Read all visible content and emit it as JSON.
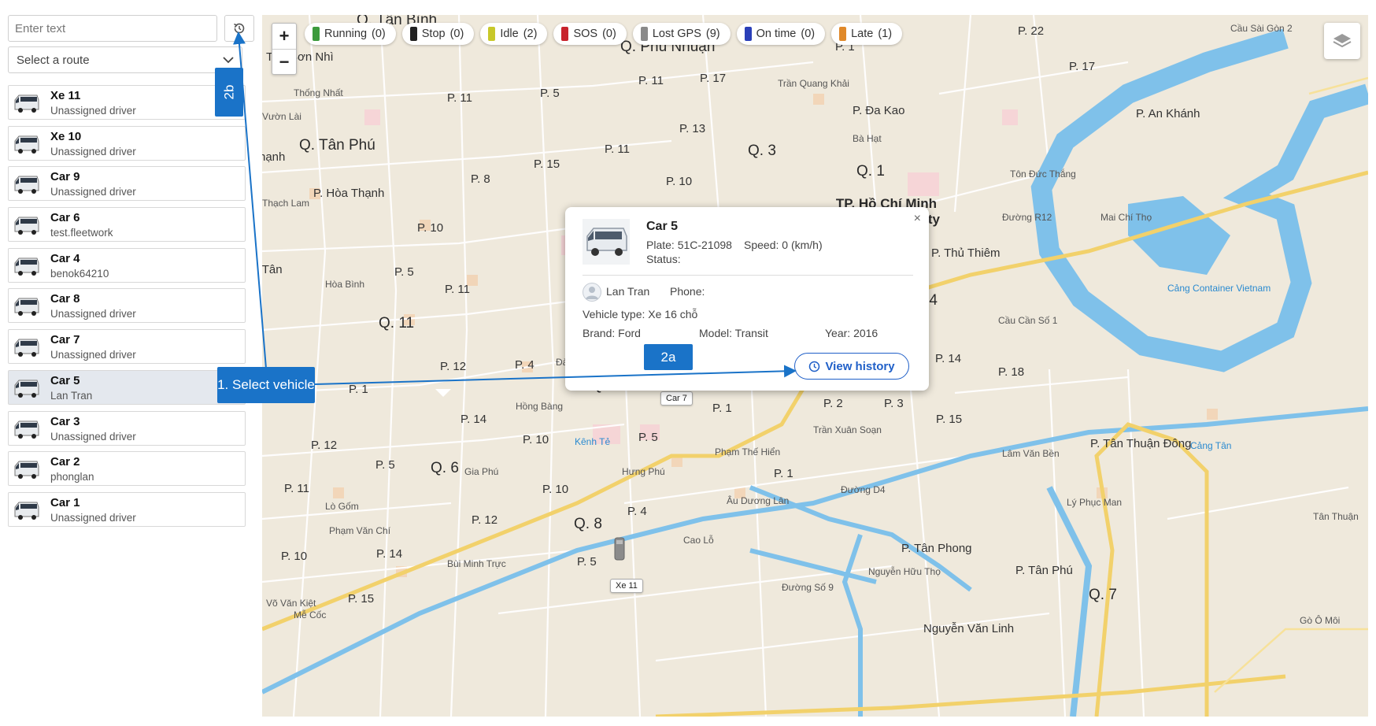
{
  "search": {
    "placeholder": "Enter text"
  },
  "route_select": {
    "label": "Select a route"
  },
  "vehicles": [
    {
      "name": "Xe 11",
      "driver": "Unassigned driver"
    },
    {
      "name": "Xe 10",
      "driver": "Unassigned driver"
    },
    {
      "name": "Car 9",
      "driver": "Unassigned driver"
    },
    {
      "name": "Car 6",
      "driver": "test.fleetwork"
    },
    {
      "name": "Car 4",
      "driver": "benok64210"
    },
    {
      "name": "Car 8",
      "driver": "Unassigned driver"
    },
    {
      "name": "Car 7",
      "driver": "Unassigned driver"
    },
    {
      "name": "Car 5",
      "driver": "Lan Tran",
      "selected": true
    },
    {
      "name": "Car 3",
      "driver": "Unassigned driver"
    },
    {
      "name": "Car 2",
      "driver": "phonglan"
    },
    {
      "name": "Car 1",
      "driver": "Unassigned driver"
    }
  ],
  "status_filters": [
    {
      "label": "Running",
      "count": "(0)",
      "color": "#3c9a3c"
    },
    {
      "label": "Stop",
      "count": "(0)",
      "color": "#222222"
    },
    {
      "label": "Idle",
      "count": "(2)",
      "color": "#c8c82a"
    },
    {
      "label": "SOS",
      "count": "(0)",
      "color": "#c8232c"
    },
    {
      "label": "Lost GPS",
      "count": "(9)",
      "color": "#8a8a8a"
    },
    {
      "label": "On time",
      "count": "(0)",
      "color": "#2a3fb8"
    },
    {
      "label": "Late",
      "count": "(1)",
      "color": "#e0892a"
    }
  ],
  "zoom": {
    "in": "+",
    "out": "−"
  },
  "popup": {
    "close": "×",
    "title": "Car 5",
    "plate": "Plate: 51C-21098",
    "speed": "Speed: 0 (km/h)",
    "status": "Status:",
    "driver": "Lan Tran",
    "phone": "Phone:",
    "vehicle_type": "Vehicle type: Xe 16 chỗ",
    "brand": "Brand: Ford",
    "model": "Model: Transit",
    "year": "Year: 2016",
    "history_button": "View history"
  },
  "markers": {
    "car7": "Car 7",
    "xe11": "Xe 11"
  },
  "annotations": {
    "select_vehicle": "1. Select vehicle",
    "a2": "2a",
    "b2": "2b"
  },
  "map_labels": {
    "l01": "Q. Tân Bình",
    "l02": "Tân Sơn Nhì",
    "l03": "Q. Phú Nhuận",
    "l04": "P. 22",
    "l05": "Cầu Sài Gòn 2",
    "l06": "P. 1",
    "l07": "P. 17",
    "l08": "P. 11",
    "l09": "P. 17",
    "l10": "P. 5",
    "l11": "P. 11",
    "l12": "Thống Nhất",
    "l13": "Vườn Lài",
    "l14": "P. Đa Kao",
    "l15": "P. An Khánh",
    "l16": "Q. Tân Phú",
    "l17": "P. 13",
    "l18": "P. 11",
    "l19": "Q. 3",
    "l20": "Q. 1",
    "l21": "P. 15",
    "l22": "hạnh",
    "l23": "P. 8",
    "l24": "P. 10",
    "l25": "TP. Hồ Chí Minh\nHo Chi Minh City",
    "l26": "P. Hòa Thạnh",
    "l27": "Thạch Lam",
    "l28": "P. 10",
    "l29": "P. Thủ Thiêm",
    "l30": "Hiệp Tân",
    "l31": "P. 5",
    "l32": "Hòa Bình",
    "l33": "P. 11",
    "l34": "Q. 4",
    "l35": "Cảng Container Vietnam",
    "l36": "Q. 11",
    "l37": "Cầu Cần Số 1",
    "l38": "P. 14",
    "l39": "P. 12",
    "l40": "P. 4",
    "l41": "Đào Duy Từ",
    "l42": "P. 6",
    "l43": "P. 14",
    "l44": "P. 18",
    "l45": "P. 1",
    "l46": "Q. 5",
    "l47": "P. 2",
    "l48": "P. 3",
    "l49": "P. 1",
    "l50": "Hồng Bàng",
    "l51": "P. 14",
    "l52": "P. 15",
    "l53": "Trần Xuân Soạn",
    "l54": "P. 10",
    "l55": "P. 5",
    "l56": "Kênh Tẻ",
    "l57": "P. 12",
    "l58": "P. Tân Thuận Đông",
    "l59": "Cảng Tân",
    "l60": "Phạm Thế Hiển",
    "l61": "P. 5",
    "l62": "Q. 6",
    "l63": "Gia Phú",
    "l64": "Hưng Phú",
    "l65": "P. 1",
    "l66": "P. 11",
    "l67": "P. 10",
    "l68": "Đường D4",
    "l69": "Lý Phục Man",
    "l70": "Lò Gốm",
    "l71": "P. 12",
    "l72": "P. 4",
    "l73": "Q. 8",
    "l74": "Phạm Văn Chí",
    "l75": "P. 10",
    "l76": "P. Tân Phong",
    "l77": "P. 14",
    "l78": "P. Tân Phú",
    "l79": "P. 5",
    "l80": "Q. 7",
    "l81": "Bùi Minh Trực",
    "l82": "Võ Văn Kiệt",
    "l83": "P. 15",
    "l84": "Nguyễn Văn Linh",
    "l85": "Gò Ô Môi",
    "l86": "Mễ Cốc",
    "l87": "Cao Lỗ",
    "l88": "Âu Dương Lân",
    "l89": "Đường Số 9",
    "l90": "Nguyễn Hữu Thọ",
    "l91": "Lâm Văn Bền",
    "l92": "Tân Thuận",
    "l93": "Võ Văn Kiệt",
    "l94": "Đường R12",
    "l95": "Mai Chí Thọ",
    "l96": "Tôn Đức Thắng",
    "l97": "Trần Quang Khải",
    "l98": "Bà Hạt"
  }
}
